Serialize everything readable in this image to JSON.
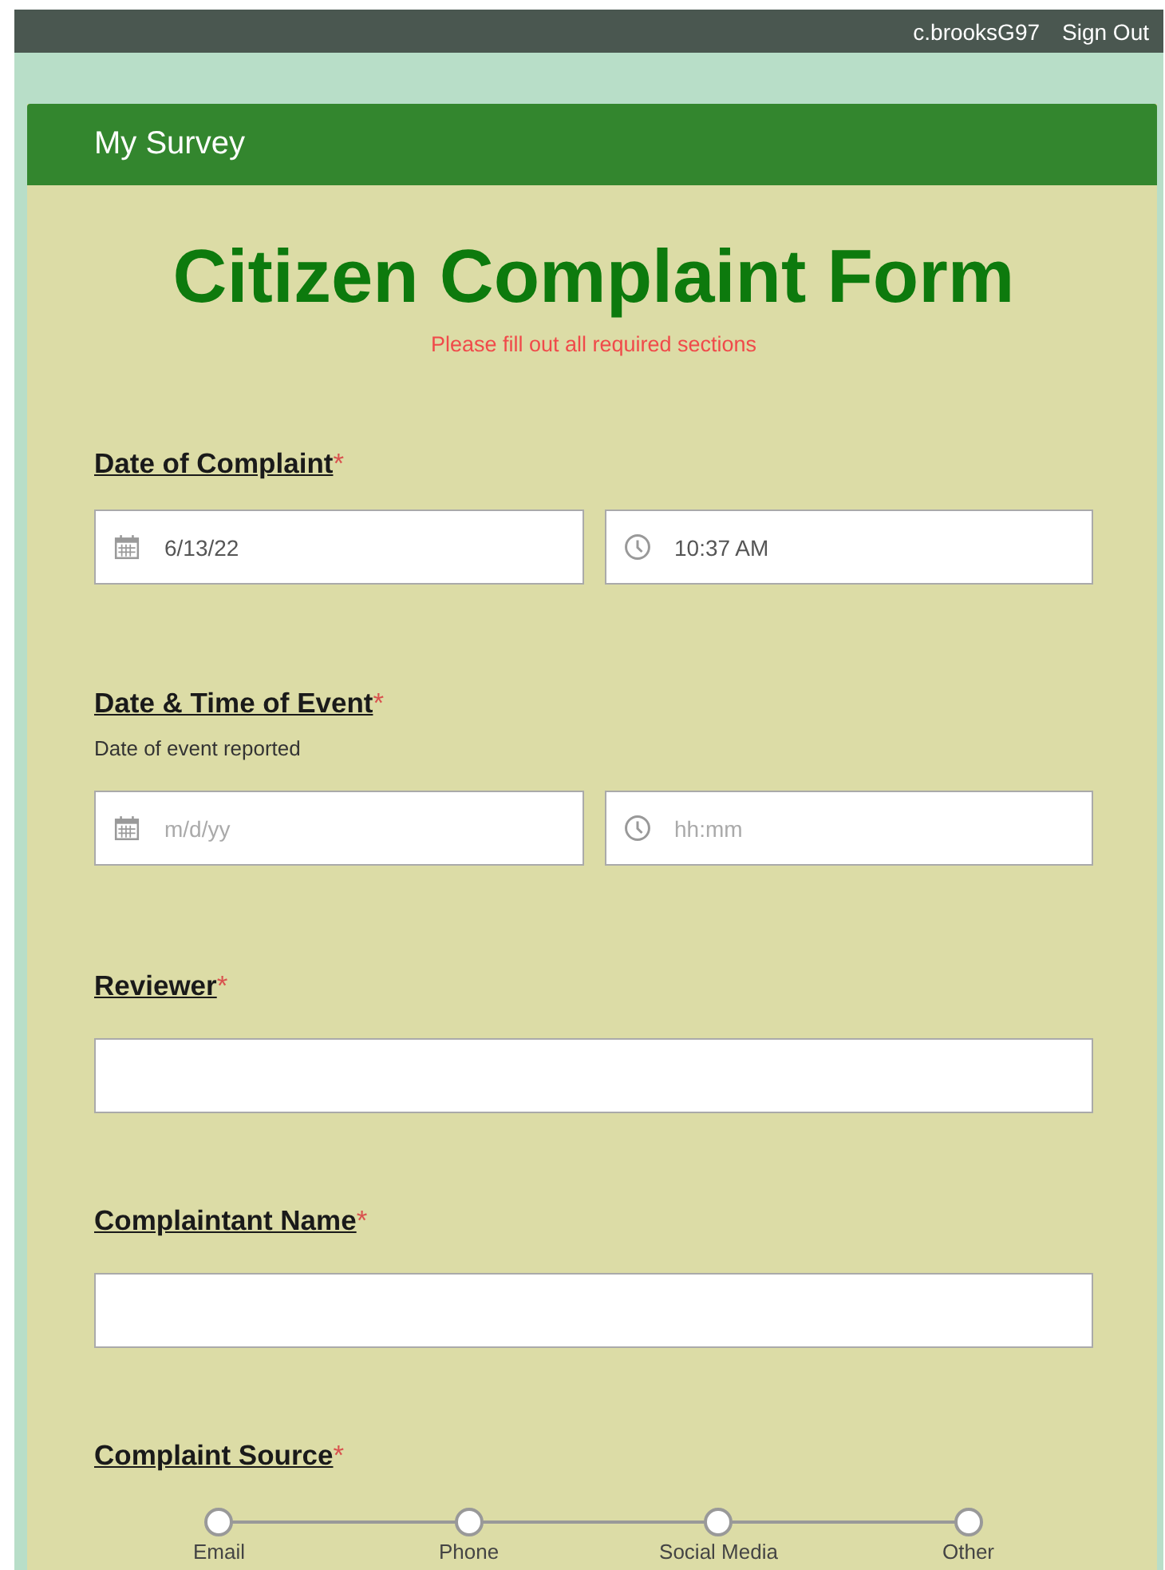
{
  "top_bar": {
    "username": "c.brooksG97",
    "sign_out": "Sign Out"
  },
  "survey": {
    "title": "My Survey"
  },
  "form": {
    "title": "Citizen Complaint Form",
    "notice": "Please fill out all required sections"
  },
  "questions": [
    {
      "kind": "datetime",
      "label": "Date of Complaint",
      "required_mark": "*",
      "date": {
        "value": "6/13/22"
      },
      "time": {
        "value": "10:37 AM"
      }
    },
    {
      "kind": "datetime",
      "label": "Date & Time of Event",
      "required_mark": "*",
      "hint": "Date of event reported",
      "date": {
        "placeholder": "m/d/yy"
      },
      "time": {
        "placeholder": "hh:mm"
      }
    },
    {
      "kind": "text",
      "label": "Reviewer",
      "required_mark": "*"
    },
    {
      "kind": "text",
      "label": "Complaintant Name",
      "required_mark": "*"
    },
    {
      "kind": "choice",
      "label": "Complaint Source",
      "required_mark": "*",
      "options": [
        {
          "label": "Email",
          "selected": false
        },
        {
          "label": "Phone",
          "selected": false
        },
        {
          "label": "Social Media",
          "selected": false
        },
        {
          "label": "Other",
          "selected": false
        }
      ]
    }
  ]
}
